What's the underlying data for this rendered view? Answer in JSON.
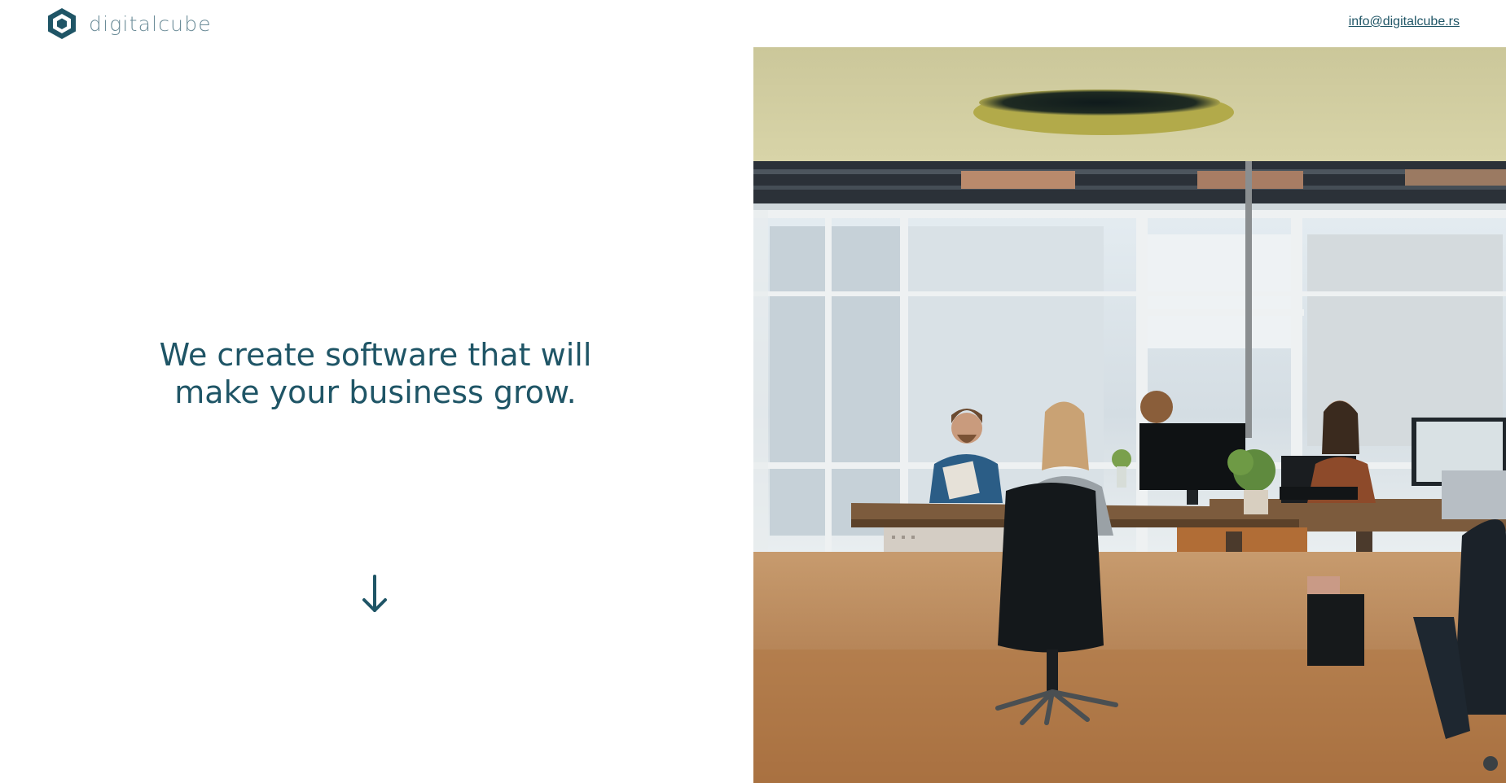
{
  "header": {
    "brand": "digitalcube",
    "logo_icon": "hexagon-cube-logo-icon",
    "email": "info@digitalcube.rs"
  },
  "hero": {
    "line1": "We create software that will",
    "line2": "make your business grow.",
    "scroll_icon": "arrow-down-icon"
  },
  "photo": {
    "subject": "office-team-photo"
  },
  "colors": {
    "brand": "#1f5566",
    "brand_light": "#6b8c98",
    "background": "#ffffff"
  }
}
